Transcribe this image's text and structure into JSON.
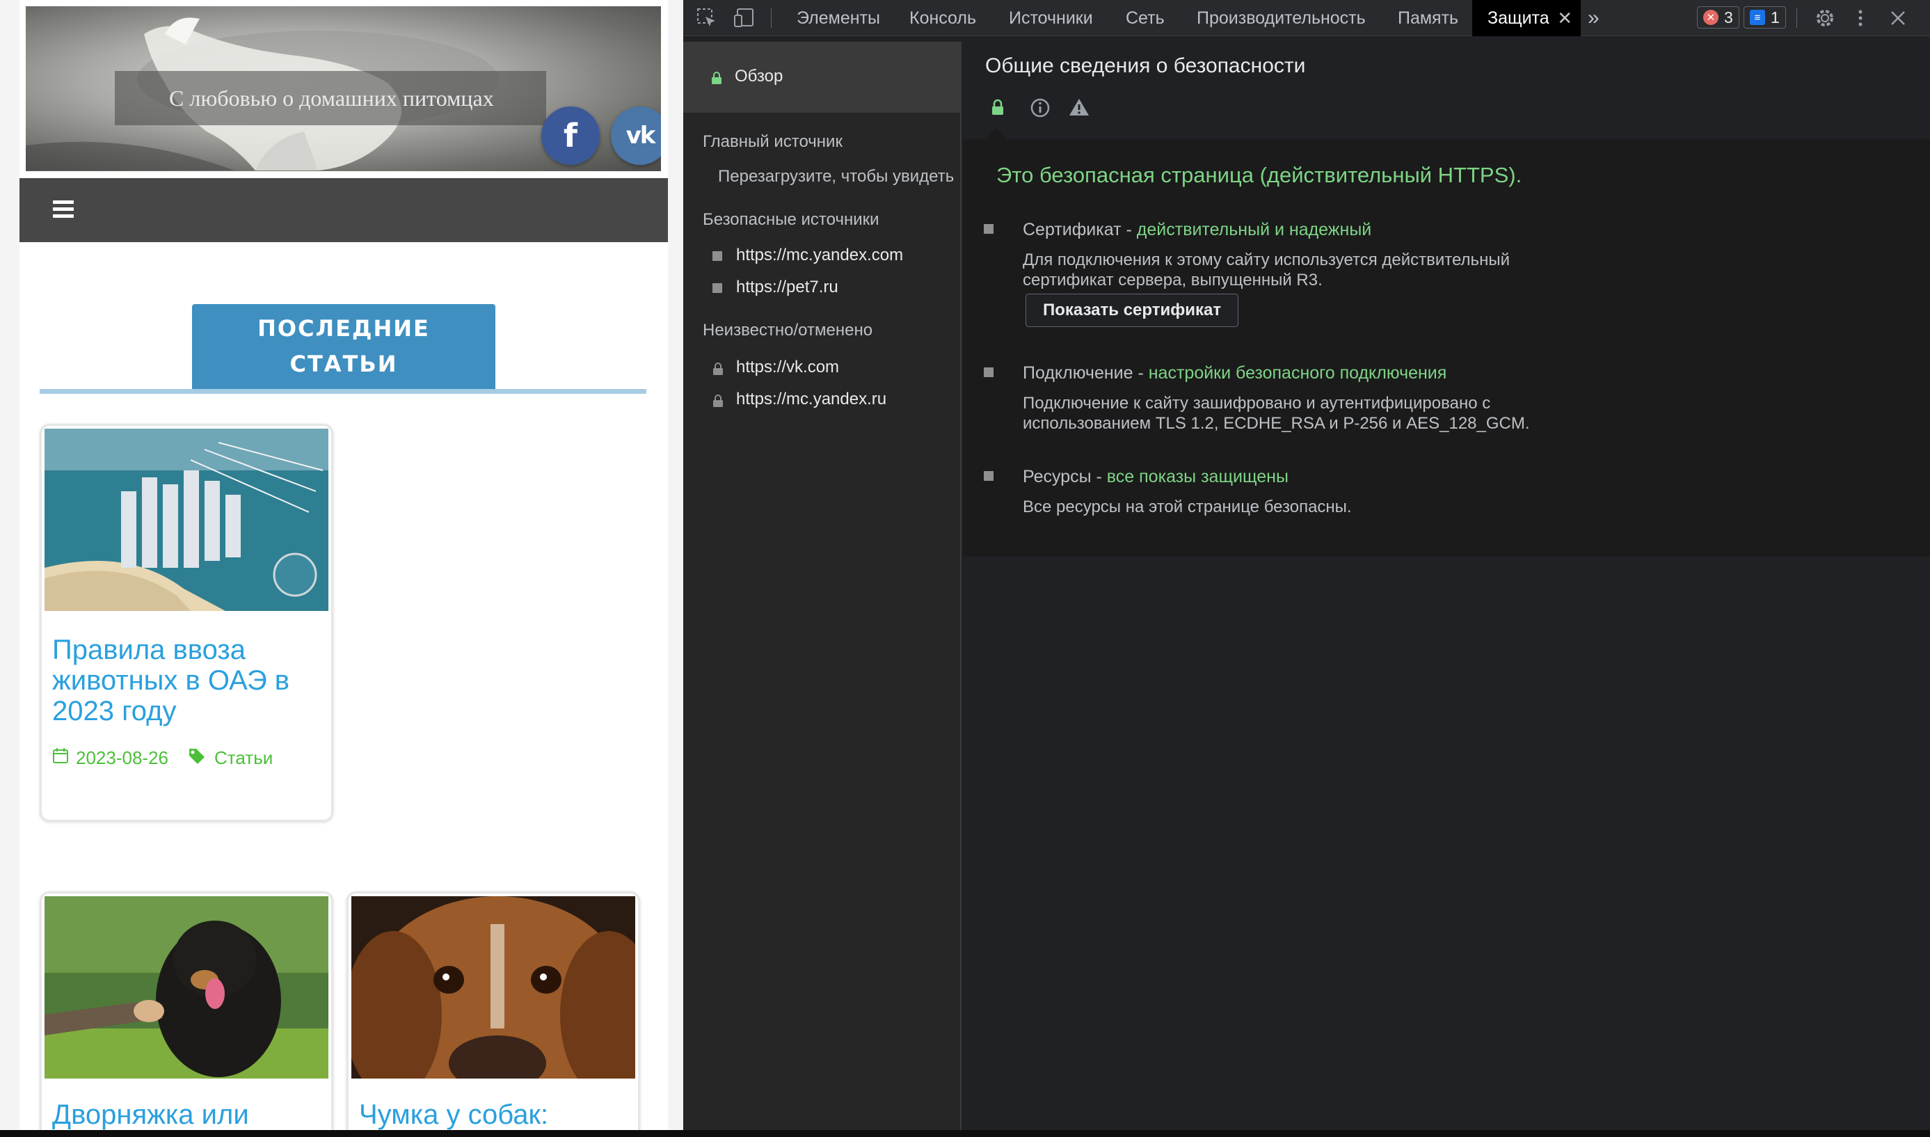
{
  "website": {
    "tagline": "С любовью о домашних питомцах",
    "social": {
      "facebook": "f",
      "vk": "vk"
    },
    "section_heading_line1": "ПОСЛЕДНИЕ",
    "section_heading_line2": "СТАТЬИ",
    "articles": [
      {
        "title": "Правила ввоза животных в ОАЭ в 2023 году",
        "date": "2023-08-26",
        "category": "Статьи"
      },
      {
        "title": "Дворняжка или",
        "date": "",
        "category": ""
      },
      {
        "title": "Чумка у собак:",
        "date": "",
        "category": ""
      }
    ],
    "colors": {
      "link": "#2aa0de",
      "meta": "#4cbf3a",
      "heading_bg": "#3f8fc1",
      "nav_bg": "#474747"
    }
  },
  "devtools": {
    "tabs": [
      "Элементы",
      "Консоль",
      "Источники",
      "Сеть",
      "Производительность",
      "Память",
      "Защита"
    ],
    "active_tab": "Защита",
    "more_tabs_icon": "»",
    "errors_count": "3",
    "messages_count": "1",
    "sidebar": {
      "overview": "Обзор",
      "main_origin_heading": "Главный источник",
      "main_origin_hint": "Перезагрузите, чтобы увидеть",
      "secure_heading": "Безопасные источники",
      "secure_origins": [
        "https://mc.yandex.com",
        "https://pet7.ru"
      ],
      "unknown_heading": "Неизвестно/отменено",
      "unknown_origins": [
        "https://vk.com",
        "https://mc.yandex.ru"
      ]
    },
    "main": {
      "title": "Общие сведения о безопасности",
      "summary": "Это безопасная страница (действительный HTTPS).",
      "certificate": {
        "label": "Сертификат - ",
        "status": "действительный и надежный",
        "description": "Для подключения к этому сайту используется действительный сертификат сервера, выпущенный R3.",
        "button": "Показать сертификат"
      },
      "connection": {
        "label": "Подключение - ",
        "status": "настройки безопасного подключения",
        "description": "Подключение к сайту зашифровано и аутентифицировано с использованием TLS 1.2, ECDHE_RSA и P-256 и AES_128_GCM."
      },
      "resources": {
        "label": "Ресурсы - ",
        "status": "все показы защищены",
        "description": "Все ресурсы на этой странице безопасны."
      }
    },
    "colors": {
      "secure_green": "#7ed486",
      "panel_bg": "#202124",
      "error_red": "#e46962",
      "info_blue": "#1a73e8"
    }
  }
}
